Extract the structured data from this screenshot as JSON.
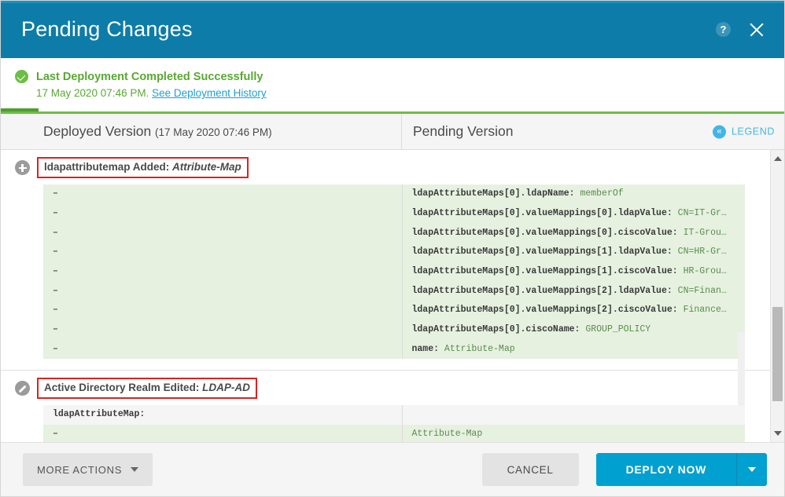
{
  "window": {
    "title": "Pending Changes",
    "help_icon": "help-icon",
    "close_icon": "close-icon"
  },
  "status": {
    "icon": "check-circle-icon",
    "title": "Last Deployment Completed Successfully",
    "timestamp": "17 May 2020 07:46 PM.",
    "link": "See Deployment History"
  },
  "columns": {
    "deployed_label": "Deployed Version",
    "deployed_date": "(17 May 2020 07:46 PM)",
    "pending_label": "Pending Version",
    "legend_label": "LEGEND",
    "legend_icon": "double-chevron-left-icon"
  },
  "sections": [
    {
      "icon": "plus-circle-icon",
      "title_prefix": "ldapattributemap Added: ",
      "title_object": "Attribute-Map",
      "rows": [
        {
          "type": "added",
          "left": "–",
          "key": "ldapAttributeMaps[0].ldapName:",
          "value": "memberOf"
        },
        {
          "type": "added",
          "left": "–",
          "key": "ldapAttributeMaps[0].valueMappings[0].ldapValue:",
          "value": "CN=IT-Gr…"
        },
        {
          "type": "added",
          "left": "–",
          "key": "ldapAttributeMaps[0].valueMappings[0].ciscoValue:",
          "value": "IT-Grou…"
        },
        {
          "type": "added",
          "left": "–",
          "key": "ldapAttributeMaps[0].valueMappings[1].ldapValue:",
          "value": "CN=HR-Gr…"
        },
        {
          "type": "added",
          "left": "–",
          "key": "ldapAttributeMaps[0].valueMappings[1].ciscoValue:",
          "value": "HR-Grou…"
        },
        {
          "type": "added",
          "left": "–",
          "key": "ldapAttributeMaps[0].valueMappings[2].ldapValue:",
          "value": "CN=Finan…"
        },
        {
          "type": "added",
          "left": "–",
          "key": "ldapAttributeMaps[0].valueMappings[2].ciscoValue:",
          "value": "Finance…"
        },
        {
          "type": "added",
          "left": "–",
          "key": "ldapAttributeMaps[0].ciscoName:",
          "value": "GROUP_POLICY"
        },
        {
          "type": "added",
          "left": "–",
          "key": "name:",
          "value": "Attribute-Map"
        }
      ]
    },
    {
      "icon": "pencil-circle-icon",
      "title_prefix": "Active Directory Realm Edited: ",
      "title_object": "LDAP-AD",
      "rows": [
        {
          "type": "plain",
          "left": "ldapAttributeMap:",
          "key": "",
          "value": ""
        },
        {
          "type": "added",
          "left": "–",
          "key": "",
          "value": "Attribute-Map"
        }
      ]
    }
  ],
  "footer": {
    "more_actions": "MORE ACTIONS",
    "more_actions_caret": "chevron-down-icon",
    "cancel": "CANCEL",
    "deploy": "DEPLOY NOW",
    "deploy_caret": "chevron-down-icon"
  },
  "colors": {
    "brand_blue": "#0d7ca8",
    "action_blue": "#00a0d1",
    "link_blue": "#1f9fd4",
    "success_green": "#6cbe45",
    "added_row": "#e6f1e0",
    "highlight_red": "#e02020"
  }
}
